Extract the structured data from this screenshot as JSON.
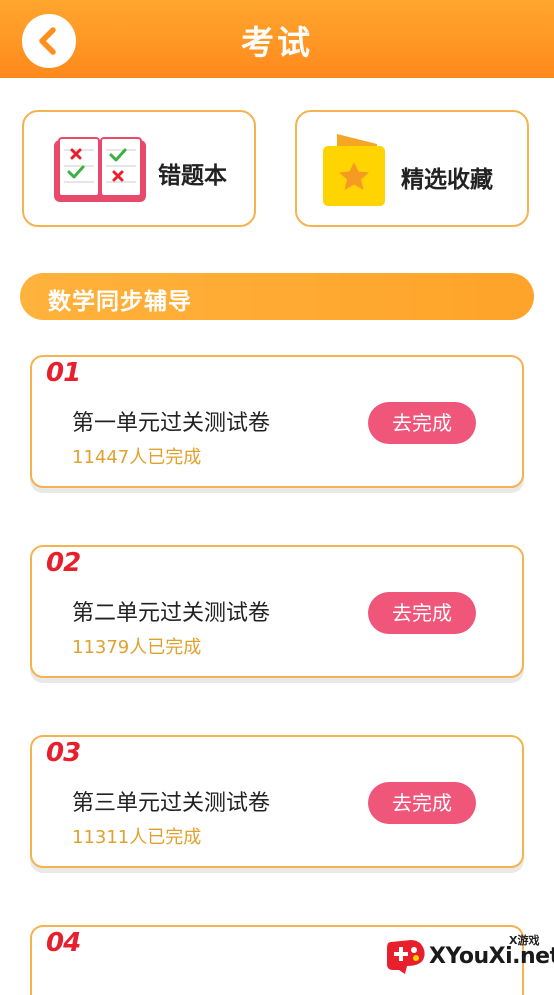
{
  "header": {
    "title": "考试",
    "back_icon": "chevron-left-icon"
  },
  "shortcuts": {
    "wrong_book": {
      "label": "错题本",
      "icon": "notebook-icon"
    },
    "favorites": {
      "label": "精选收藏",
      "icon": "star-folder-icon"
    }
  },
  "section": {
    "title": "数学同步辅导"
  },
  "exams": [
    {
      "num": "01",
      "title": "第一单元过关测试卷",
      "count": "11447人已完成",
      "button": "去完成"
    },
    {
      "num": "02",
      "title": "第二单元过关测试卷",
      "count": "11379人已完成",
      "button": "去完成"
    },
    {
      "num": "03",
      "title": "第三单元过关测试卷",
      "count": "11311人已完成",
      "button": "去完成"
    },
    {
      "num": "04"
    }
  ],
  "watermark": {
    "small": "X游戏",
    "text": "XYouXi.net"
  },
  "colors": {
    "header_orange": "#ff8a1c",
    "card_border": "#f5b350",
    "button_pink": "#f0557a",
    "count_gold": "#e0a22e",
    "number_red": "#e8202e"
  }
}
